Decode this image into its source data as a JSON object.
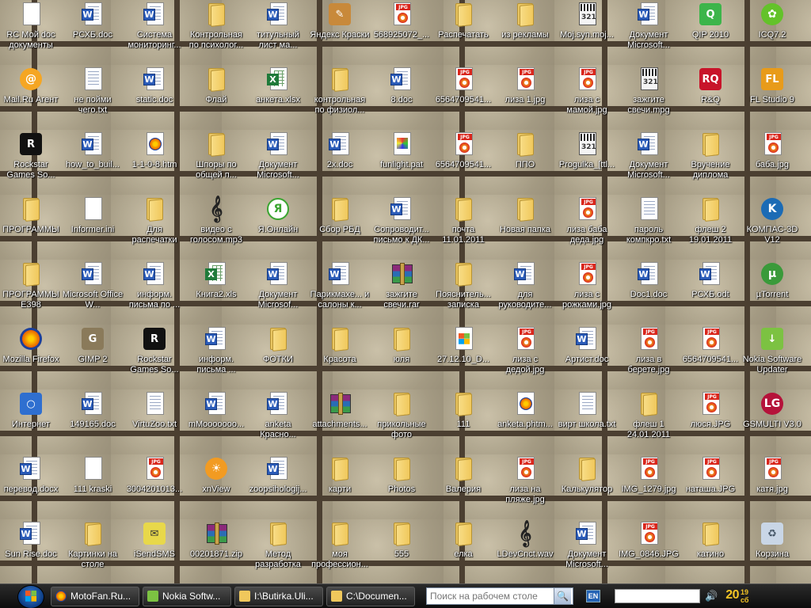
{
  "desktop": {
    "columns": [
      {
        "items": [
          {
            "label": "RC Мой doc документы",
            "kind": "generic"
          },
          {
            "label": "Mail.Ru Агент",
            "kind": "mailru"
          },
          {
            "label": "Rockstar Games So...",
            "kind": "rockstar"
          },
          {
            "label": "ПРОГРАММЫ",
            "kind": "folder"
          },
          {
            "label": "ПРОГРАММЫ E398",
            "kind": "folder"
          },
          {
            "label": "Mozilla Firefox",
            "kind": "firefox"
          },
          {
            "label": "Интернет",
            "kind": "network"
          },
          {
            "label": "перевод.docx",
            "kind": "doc"
          },
          {
            "label": "Sun Rise.doc",
            "kind": "doc"
          }
        ]
      },
      {
        "items": [
          {
            "label": "РСХБ.doc",
            "kind": "doc"
          },
          {
            "label": "не пойми чего.txt",
            "kind": "txt"
          },
          {
            "label": "how_to_buil...",
            "kind": "doc"
          },
          {
            "label": "Informer.ini",
            "kind": "ini"
          },
          {
            "label": "Microsoft Office W...",
            "kind": "doc"
          },
          {
            "label": "GIMP 2",
            "kind": "gimp"
          },
          {
            "label": "149165.doc",
            "kind": "doc"
          },
          {
            "label": "111 kraski",
            "kind": "generic"
          },
          {
            "label": "Картинки на столе",
            "kind": "folder"
          }
        ]
      },
      {
        "items": [
          {
            "label": "Система мониторинг...",
            "kind": "doc"
          },
          {
            "label": "static.doc",
            "kind": "doc"
          },
          {
            "label": "1-1-0-8.htm",
            "kind": "htm"
          },
          {
            "label": "Для распечатки",
            "kind": "folder"
          },
          {
            "label": "информ. письма по ...",
            "kind": "doc"
          },
          {
            "label": "Rockstar Games So...",
            "kind": "rockstar"
          },
          {
            "label": "VirtuZoo.txt",
            "kind": "txt"
          },
          {
            "label": "3004201013...",
            "kind": "jpg"
          },
          {
            "label": "iSendSMS",
            "kind": "isendsms"
          }
        ]
      },
      {
        "items": [
          {
            "label": "Контрольная по психолог...",
            "kind": "folder"
          },
          {
            "label": "Флай",
            "kind": "folder"
          },
          {
            "label": "Шпоры по общей п...",
            "kind": "folder"
          },
          {
            "label": "видео с голосом.mp3",
            "kind": "note"
          },
          {
            "label": "Книга2.xls",
            "kind": "xls"
          },
          {
            "label": "информ. письма ...",
            "kind": "doc"
          },
          {
            "label": "mMooooooo...",
            "kind": "doc"
          },
          {
            "label": "xnView",
            "kind": "xnview"
          },
          {
            "label": "00201871.zip",
            "kind": "rar"
          }
        ]
      },
      {
        "items": [
          {
            "label": "титульный лист ма...",
            "kind": "doc"
          },
          {
            "label": "анкета.xlsx",
            "kind": "xls"
          },
          {
            "label": "Документ Microsoft...",
            "kind": "doc"
          },
          {
            "label": "Я.Онлайн",
            "kind": "yaonline"
          },
          {
            "label": "Документ Microsof...",
            "kind": "doc"
          },
          {
            "label": "ФОТКИ",
            "kind": "folder"
          },
          {
            "label": "anketa Красно...",
            "kind": "doc"
          },
          {
            "label": "zoopsihologij...",
            "kind": "doc"
          },
          {
            "label": "Метод разработка",
            "kind": "folder"
          }
        ]
      },
      {
        "items": [
          {
            "label": "Яндекс Краски",
            "kind": "paint"
          },
          {
            "label": "контрольная по физиол...",
            "kind": "folder"
          },
          {
            "label": "2x.doc",
            "kind": "doc"
          },
          {
            "label": "Сбор РБД",
            "kind": "folder"
          },
          {
            "label": "Парикмахе... и салоны к...",
            "kind": "doc"
          },
          {
            "label": "Красота",
            "kind": "folder"
          },
          {
            "label": "attachments...",
            "kind": "rar"
          },
          {
            "label": "карти",
            "kind": "folder"
          },
          {
            "label": "моя профессион...",
            "kind": "folder"
          }
        ]
      },
      {
        "items": [
          {
            "label": "568925072_...",
            "kind": "jpg"
          },
          {
            "label": "8.doc",
            "kind": "doc"
          },
          {
            "label": "funlight.pat",
            "kind": "pat"
          },
          {
            "label": "Сопроводит... письмо к ДК...",
            "kind": "doc"
          },
          {
            "label": "зажгите свечи.rar",
            "kind": "rar"
          },
          {
            "label": "юля",
            "kind": "folder"
          },
          {
            "label": "прикольные фото",
            "kind": "folder"
          },
          {
            "label": "Photos",
            "kind": "folder"
          },
          {
            "label": "555",
            "kind": "folder"
          }
        ]
      },
      {
        "items": [
          {
            "label": "Распечатать",
            "kind": "folder"
          },
          {
            "label": "6564709541...",
            "kind": "jpg"
          },
          {
            "label": "6564709541...",
            "kind": "jpg"
          },
          {
            "label": "почта 11.01.2011",
            "kind": "folder"
          },
          {
            "label": "Пояснитель... записка",
            "kind": "folder"
          },
          {
            "label": "27.12.10_D...",
            "kind": "setup"
          },
          {
            "label": "111",
            "kind": "folder"
          },
          {
            "label": "Валерия",
            "kind": "folder"
          },
          {
            "label": "елка",
            "kind": "folder"
          }
        ]
      },
      {
        "items": [
          {
            "label": "из рекламы",
            "kind": "folder"
          },
          {
            "label": "лиза 1.jpg",
            "kind": "jpg"
          },
          {
            "label": "ППО",
            "kind": "folder"
          },
          {
            "label": "Новая папка",
            "kind": "folder"
          },
          {
            "label": "для руководите...",
            "kind": "doc"
          },
          {
            "label": "лиза с дедой.jpg",
            "kind": "jpg"
          },
          {
            "label": "anketa.phtm...",
            "kind": "htm"
          },
          {
            "label": "лиза на пляже.jpg",
            "kind": "jpg"
          },
          {
            "label": "LDevCnct.wav",
            "kind": "note"
          }
        ]
      },
      {
        "items": [
          {
            "label": "Moj.syn.moj...",
            "kind": "mpg"
          },
          {
            "label": "лиза с мамой.jpg",
            "kind": "jpg"
          },
          {
            "label": "Progulka_[ttl...",
            "kind": "mpg"
          },
          {
            "label": "лиза баба деда.jpg",
            "kind": "jpg"
          },
          {
            "label": "лиза с рожками.jpg",
            "kind": "jpg"
          },
          {
            "label": "Артист.doc",
            "kind": "doc"
          },
          {
            "label": "вирт школа.txt",
            "kind": "txt"
          },
          {
            "label": "Калькулятор",
            "kind": "folder"
          },
          {
            "label": "Документ Microsoft...",
            "kind": "doc"
          }
        ]
      },
      {
        "items": [
          {
            "label": "Документ Microsoft...",
            "kind": "doc"
          },
          {
            "label": "зажгите свечи.mpg",
            "kind": "mpg"
          },
          {
            "label": "Документ Microsoft...",
            "kind": "doc"
          },
          {
            "label": "пароль компкро.txt",
            "kind": "txt"
          },
          {
            "label": "Doc1.doc",
            "kind": "doc"
          },
          {
            "label": "лиза в берете.jpg",
            "kind": "jpg"
          },
          {
            "label": "флеш 1 24.01.2011",
            "kind": "folder"
          },
          {
            "label": "IMG_1279.jpg",
            "kind": "jpg"
          },
          {
            "label": "IMG_0846.JPG",
            "kind": "jpg"
          }
        ]
      },
      {
        "items": [
          {
            "label": "QIP 2010",
            "kind": "qip"
          },
          {
            "label": "R&Q",
            "kind": "rq"
          },
          {
            "label": "Вручение диплома",
            "kind": "folder"
          },
          {
            "label": "флеш 2 19.01.2011",
            "kind": "folder"
          },
          {
            "label": "РСХБ.odt",
            "kind": "doc"
          },
          {
            "label": "6564709541...",
            "kind": "jpg"
          },
          {
            "label": "люся.JPG",
            "kind": "jpg"
          },
          {
            "label": "наташа.JPG",
            "kind": "jpg"
          },
          {
            "label": "катино",
            "kind": "folder"
          }
        ]
      },
      {
        "items": [
          {
            "label": "ICQ7.2",
            "kind": "icq"
          },
          {
            "label": "FL Studio 9",
            "kind": "flstudio"
          },
          {
            "label": "баба.jpg",
            "kind": "jpg"
          },
          {
            "label": "КОМПАС-3D V12",
            "kind": "kompas"
          },
          {
            "label": "µTorrent",
            "kind": "utorrent"
          },
          {
            "label": "Nokia Software Updater",
            "kind": "nokia"
          },
          {
            "label": "GSMULTI V3.0",
            "kind": "lg"
          },
          {
            "label": "катя.jpg",
            "kind": "jpg"
          },
          {
            "label": "Корзина",
            "kind": "trash"
          }
        ]
      }
    ]
  },
  "taskbar": {
    "tasks": [
      {
        "label": "MotoFan.Ru...",
        "icon": "firefox-icon",
        "color": "#e66000"
      },
      {
        "label": "Nokia Softw...",
        "icon": "nokia-icon",
        "color": "#7cc242"
      },
      {
        "label": "I:\\Butirka.Uli...",
        "icon": "folder-icon",
        "color": "#f0c85c"
      },
      {
        "label": "C:\\Documen...",
        "icon": "folder-icon",
        "color": "#f0c85c"
      }
    ],
    "search_placeholder": "Поиск на рабочем столе",
    "language": "EN",
    "clock_hour": "20",
    "clock_minute": "19",
    "clock_day": "сб"
  }
}
